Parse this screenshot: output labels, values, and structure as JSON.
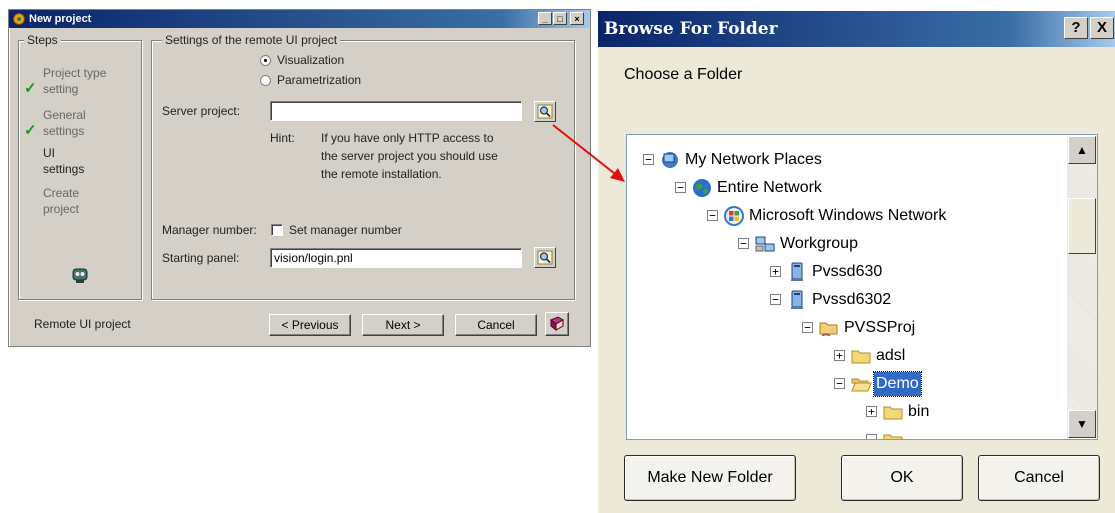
{
  "new_project": {
    "title": "New project",
    "controls": {
      "minimize": "_",
      "maximize": "□",
      "close": "×"
    },
    "steps": {
      "legend": "Steps",
      "items": [
        {
          "label": "Project type setting",
          "line1": "Project type",
          "line2": "setting",
          "done": true
        },
        {
          "label": "General settings",
          "line1": "General",
          "line2": "settings",
          "done": true
        },
        {
          "label": "UI settings",
          "line1": "UI",
          "line2": "settings",
          "done": false
        },
        {
          "label": "Create project",
          "line1": "Create",
          "line2": "project",
          "done": false
        }
      ]
    },
    "settings": {
      "legend": "Settings of the remote UI project",
      "radio_visualization": "Visualization",
      "radio_parametrization": "Parametrization",
      "selected_radio": "Visualization",
      "server_project_label": "Server project:",
      "server_project_value": "",
      "hint_label": "Hint:",
      "hint_line1": "If you have only HTTP access to",
      "hint_line2": "the server project you should use",
      "hint_line3": "the remote installation.",
      "manager_number_label": "Manager number:",
      "set_manager_number_label": "Set manager number",
      "set_manager_checked": false,
      "starting_panel_label": "Starting panel:",
      "starting_panel_value": "vision/login.pnl"
    },
    "footer_label": "Remote UI project",
    "buttons": {
      "previous": "< Previous",
      "next": "Next >",
      "cancel": "Cancel"
    }
  },
  "browse_folder": {
    "title": "Browse For Folder",
    "controls": {
      "help": "?",
      "close": "X"
    },
    "prompt": "Choose a Folder",
    "tree": [
      {
        "label": "My Network Places",
        "icon": "network-places-icon",
        "expander": "−"
      },
      {
        "label": "Entire Network",
        "icon": "globe-icon",
        "expander": "−"
      },
      {
        "label": "Microsoft Windows Network",
        "icon": "windows-network-icon",
        "expander": "−"
      },
      {
        "label": "Workgroup",
        "icon": "workgroup-icon",
        "expander": "−"
      },
      {
        "label": "Pvssd630",
        "icon": "computer-icon",
        "expander": "+"
      },
      {
        "label": "Pvssd6302",
        "icon": "computer-icon",
        "expander": "−"
      },
      {
        "label": "PVSSProj",
        "icon": "shared-folder-icon",
        "expander": "−"
      },
      {
        "label": "adsl",
        "icon": "folder-icon",
        "expander": "+"
      },
      {
        "label": "Demo",
        "icon": "folder-open-icon",
        "expander": "−",
        "selected": true
      },
      {
        "label": "bin",
        "icon": "folder-icon",
        "expander": "+"
      }
    ],
    "scroll": {
      "up": "▲",
      "down": "▼"
    },
    "buttons": {
      "make_new_folder": "Make New Folder",
      "ok": "OK",
      "cancel": "Cancel"
    }
  },
  "colors": {
    "title_bar": "#0a246a",
    "selection": "#316ac5",
    "arrow": "#e01010",
    "check": "#1a9a1a"
  }
}
